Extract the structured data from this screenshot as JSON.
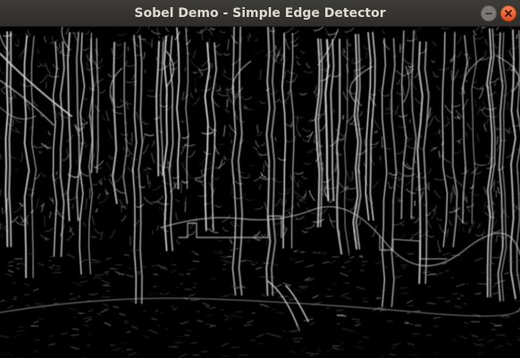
{
  "window": {
    "title": "Sobel Demo - Simple Edge Detector"
  },
  "controls": {
    "minimize_icon": "minimize-icon",
    "close_icon": "close-icon",
    "close_color": "#e95420"
  },
  "image": {
    "description_type": "sobel-edge-map"
  }
}
